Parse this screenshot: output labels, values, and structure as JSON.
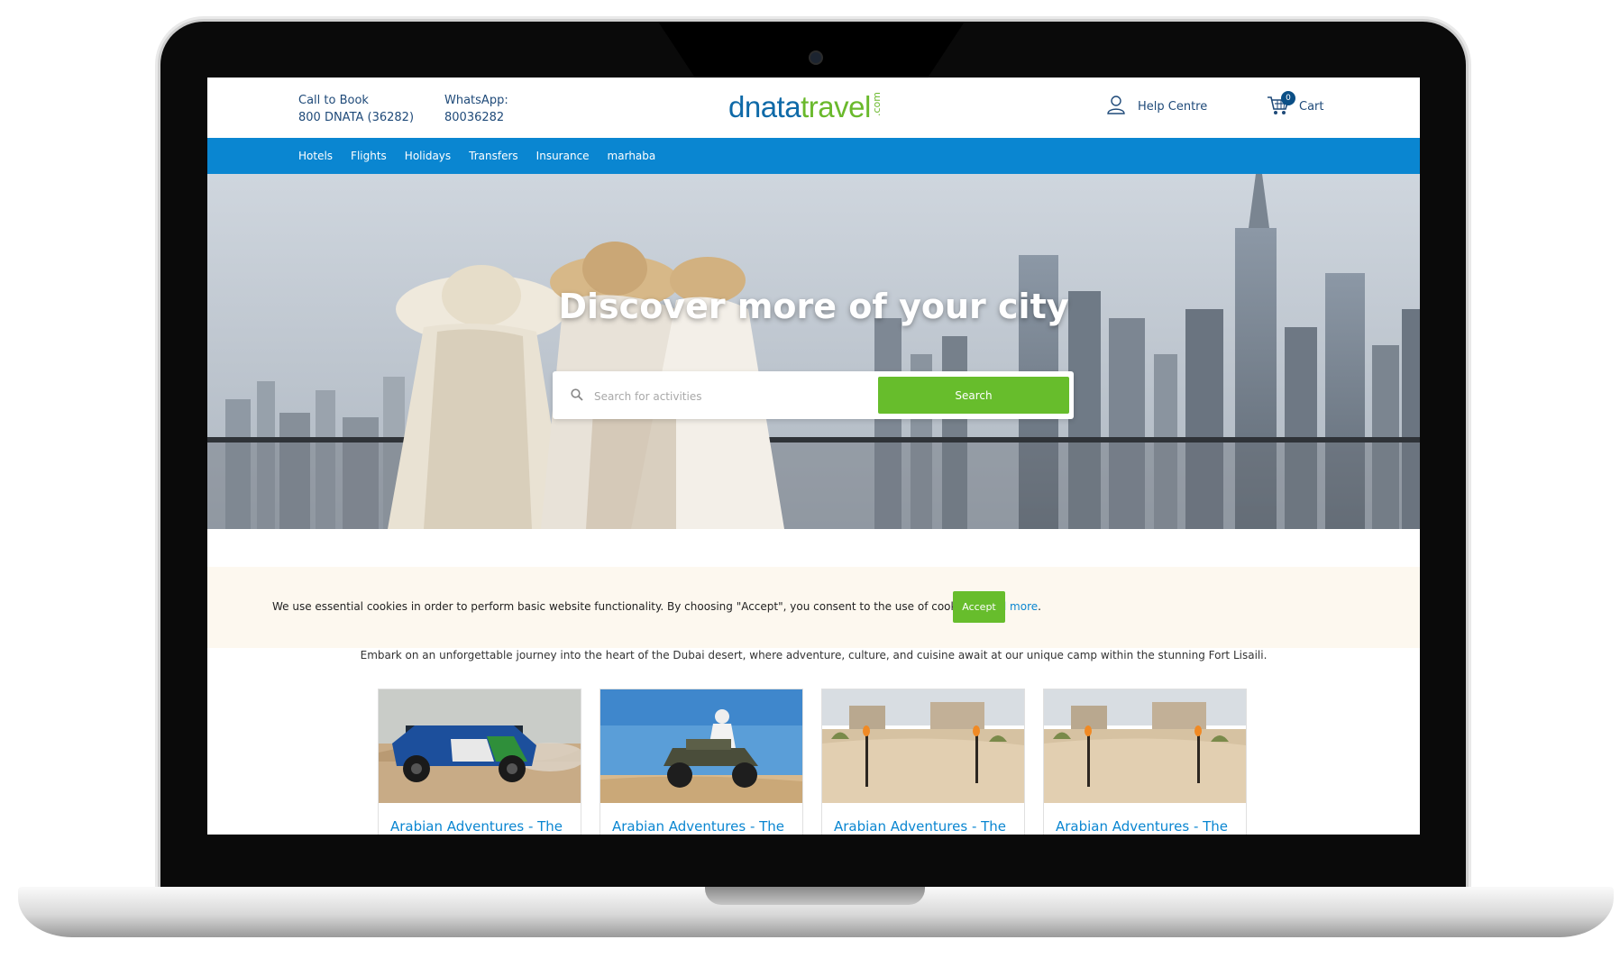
{
  "header": {
    "call_label": "Call to Book",
    "call_number": "800 DNATA (36282)",
    "whatsapp_label": "WhatsApp:",
    "whatsapp_number": "80036282",
    "logo_dnata": "dnata",
    "logo_travel": "travel",
    "logo_com": ".com",
    "help_label": "Help Centre",
    "cart_label": "Cart",
    "cart_count": "0"
  },
  "nav": {
    "items": [
      {
        "label": "Hotels"
      },
      {
        "label": "Flights"
      },
      {
        "label": "Holidays"
      },
      {
        "label": "Transfers"
      },
      {
        "label": "Insurance"
      },
      {
        "label": "marhaba"
      }
    ]
  },
  "hero": {
    "title": "Discover more of your city",
    "search_placeholder": "Search for activities",
    "search_button": "Search"
  },
  "cookie": {
    "text": "We use essential cookies in order to perform basic website functionality. By choosing \"Accept\", you consent to the use of cookies.",
    "link": "Read more",
    "accept": "Accept"
  },
  "intro": "Embark on an unforgettable journey into the heart of the Dubai desert, where adventure, culture, and cuisine await at our unique camp within the stunning Fort Lisaili.",
  "cards": [
    {
      "title": "Arabian Adventures - The",
      "image": "dune-buggy-image"
    },
    {
      "title": "Arabian Adventures - The",
      "image": "quad-bike-image"
    },
    {
      "title": "Arabian Adventures - The",
      "image": "desert-camp-image"
    },
    {
      "title": "Arabian Adventures - The",
      "image": "desert-camp-image"
    }
  ],
  "colors": {
    "brand_blue": "#0a86d1",
    "brand_green": "#67bd2c",
    "dark_blue_text": "#1f4a79",
    "cookie_bg": "#fdf8ef"
  }
}
